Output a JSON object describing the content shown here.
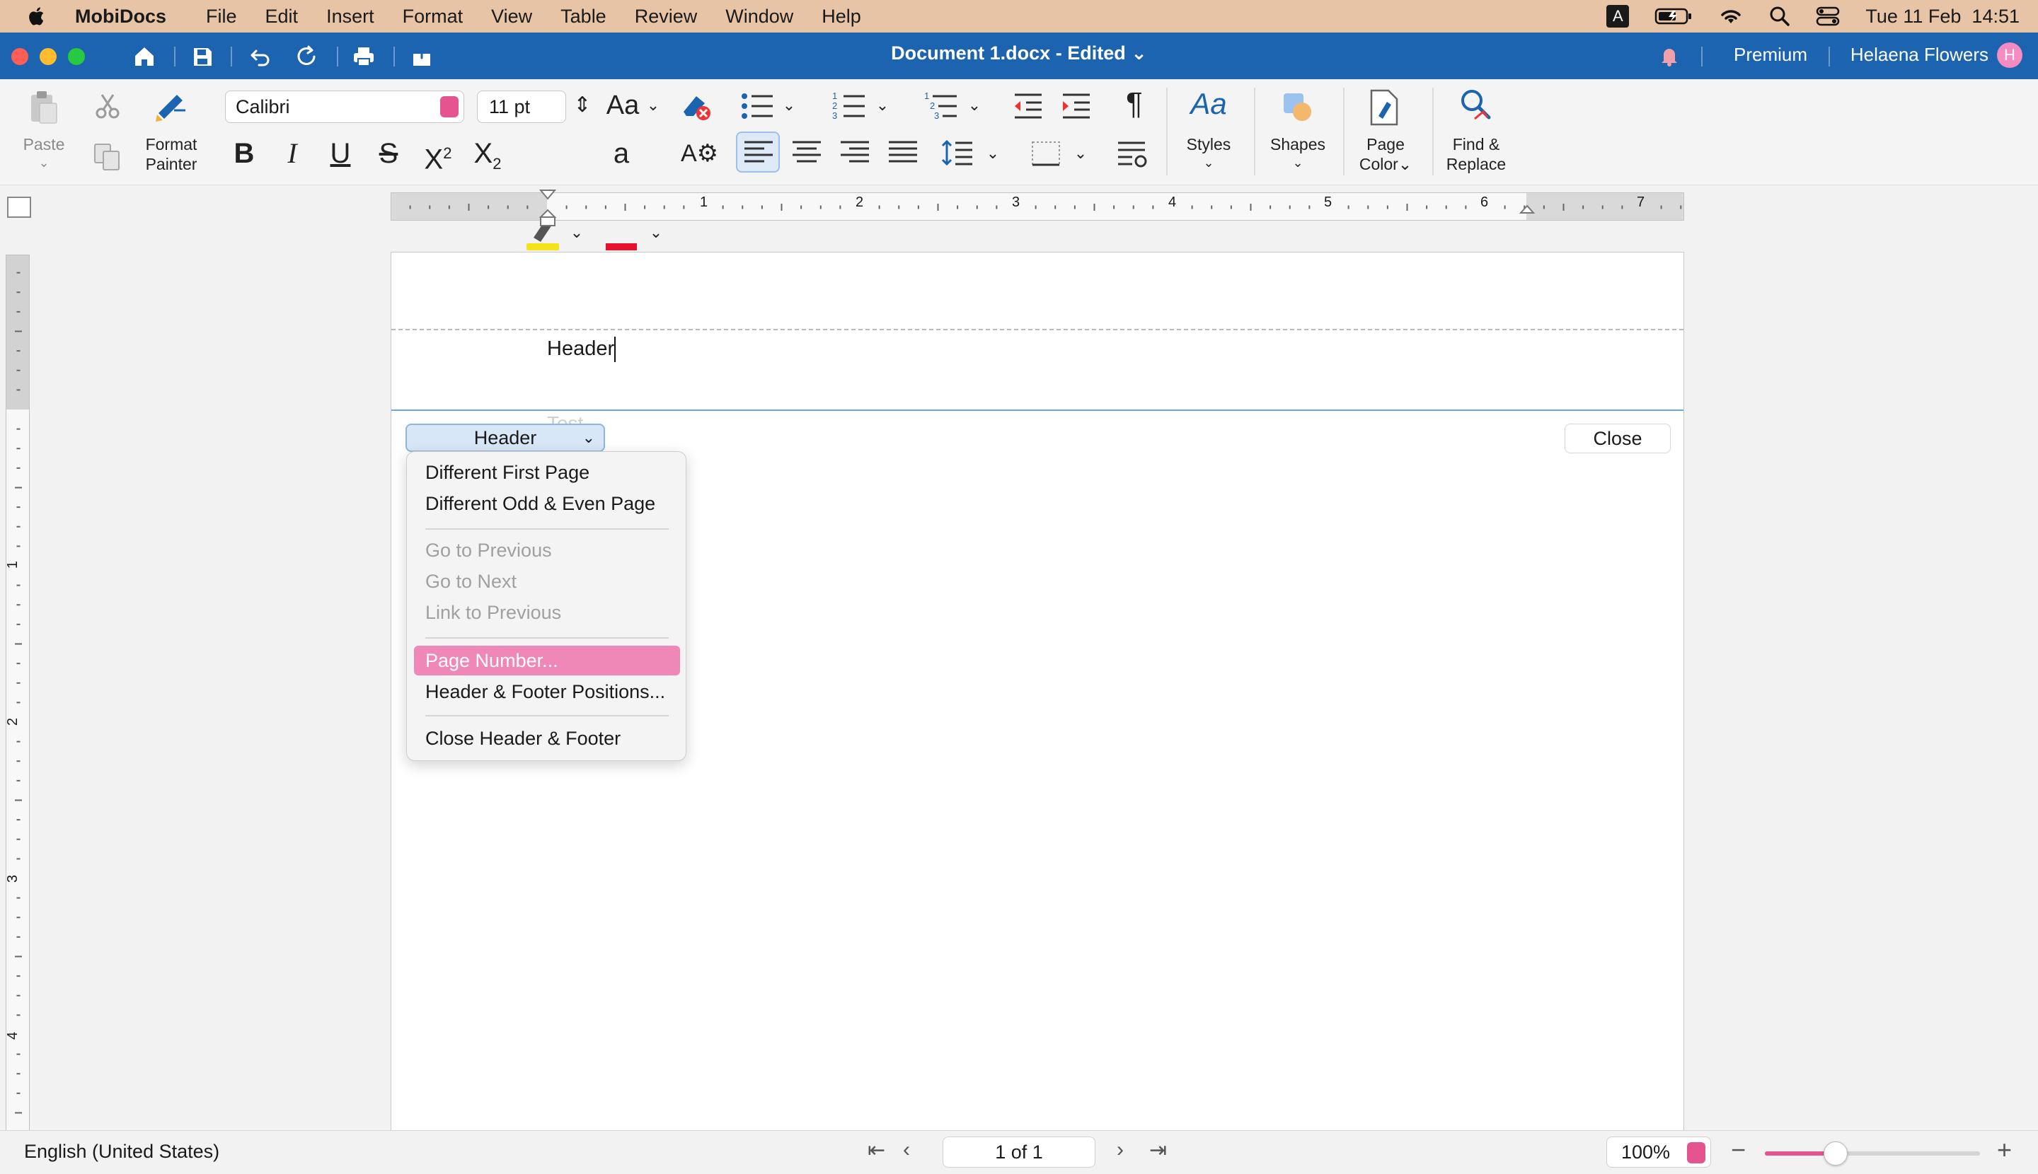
{
  "menubar": {
    "app_name": "MobiDocs",
    "items": [
      "File",
      "Edit",
      "Insert",
      "Format",
      "View",
      "Table",
      "Review",
      "Window",
      "Help"
    ],
    "input_source": "A",
    "datetime": "Tue 11 Feb  14:51"
  },
  "titlebar": {
    "doc_title": "Document 1.docx - Edited",
    "premium": "Premium",
    "user_name": "Helaena Flowers",
    "avatar_initial": "H"
  },
  "toolbar": {
    "paste": "Paste",
    "format_painter": [
      "Format",
      "Painter"
    ],
    "font_name": "Calibri",
    "font_size": "11 pt",
    "font_case": "Aa",
    "styles": "Styles",
    "shapes": "Shapes",
    "page_color": [
      "Page",
      "Color"
    ],
    "find_replace": [
      "Find &",
      "Replace"
    ]
  },
  "ruler": {
    "ticks": [
      "1",
      "2",
      "3",
      "4",
      "5",
      "6",
      "7"
    ],
    "vticks": [
      "1",
      "2",
      "3",
      "4"
    ]
  },
  "document": {
    "header_text": "Header",
    "ghost_text": "Test",
    "header_select": "Header",
    "close_label": "Close"
  },
  "dropdown": {
    "group1": [
      "Different First Page",
      "Different Odd & Even Page"
    ],
    "group2": [
      "Go to Previous",
      "Go to Next",
      "Link to Previous"
    ],
    "highlighted": "Page Number...",
    "positions": "Header & Footer Positions...",
    "close_hf": "Close Header & Footer"
  },
  "statusbar": {
    "language": "English (United States)",
    "page_indicator": "1 of 1",
    "zoom": "100%",
    "zoom_level_fraction": 0.33
  },
  "colors": {
    "menubar_bg": "#e7c4a6",
    "titlebar_bg": "#1d64b0",
    "accent_pink": "#e5548f",
    "menu_highlight": "#ef88b6"
  }
}
